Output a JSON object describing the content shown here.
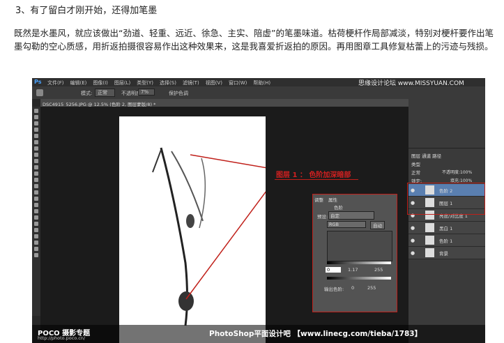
{
  "article": {
    "step_title": "3、有了留白才刚开始，还得加笔墨",
    "paragraph": "既然是水墨风，就应该做出“劲道、轻重、远近、徐急、主实、陪虚”的笔墨味道。枯荷梗杆作局部减淡，特别对梗杆要作出笔墨勾勒的空心质感，用折返拍摄很容易作出这种效果来，这是我喜爱折返拍的原因。再用图章工具修复枯蕾上的污迹与残损。"
  },
  "screenshot": {
    "logo": "Ps",
    "menu": [
      "文件(F)",
      "编辑(E)",
      "图像(I)",
      "图层(L)",
      "类型(Y)",
      "选择(S)",
      "滤镜(T)",
      "视图(V)",
      "窗口(W)",
      "帮助(H)"
    ],
    "brand": "思缘设计论坛 www.MISSYUAN.COM",
    "options": {
      "mode_label": "模式:",
      "mode_value": "正常",
      "opacity_label": "不透明度:",
      "opacity_value": "7%",
      "protect_label": "保护色调"
    },
    "doc_tab": "DSC4915_5256.JPG @ 12.5% (色阶 2, 图层蒙版/8) *",
    "annotation_label": "图层 1 ： 色阶加深暗部",
    "adj_panel": {
      "tabs": [
        "调整",
        "属性"
      ],
      "title": "色阶",
      "preset_label": "预设:",
      "preset_value": "自定",
      "channel": "RGB",
      "auto": "自动",
      "input_values": [
        "0",
        "1.17",
        "255"
      ],
      "output_label": "输出色阶:",
      "output_values": [
        "0",
        "255"
      ]
    },
    "layers_panel": {
      "tabs": [
        "图层",
        "通道",
        "路径"
      ],
      "kind": "类型",
      "blend": "正常",
      "opacity_label": "不透明度:",
      "opacity": "100%",
      "lock_label": "锁定:",
      "fill_label": "填充:",
      "fill": "100%",
      "layers": [
        {
          "name": "色阶 2",
          "selected": true
        },
        {
          "name": "图层 1",
          "selected": false
        },
        {
          "name": "亮度/对比度 1",
          "selected": false
        },
        {
          "name": "黑白 1",
          "selected": false
        },
        {
          "name": "色阶 1",
          "selected": false
        },
        {
          "name": "背景",
          "selected": false
        }
      ]
    },
    "footer": {
      "poco": "POCO 摄影专题",
      "poco_url": "http://photo.poco.cn/",
      "credit": "PhotoShop平面设计吧  【www.linecg.com/tieba/1783】"
    },
    "colors": {
      "annotation": "#c0201a",
      "selected_layer": "#5a7fb0"
    }
  }
}
